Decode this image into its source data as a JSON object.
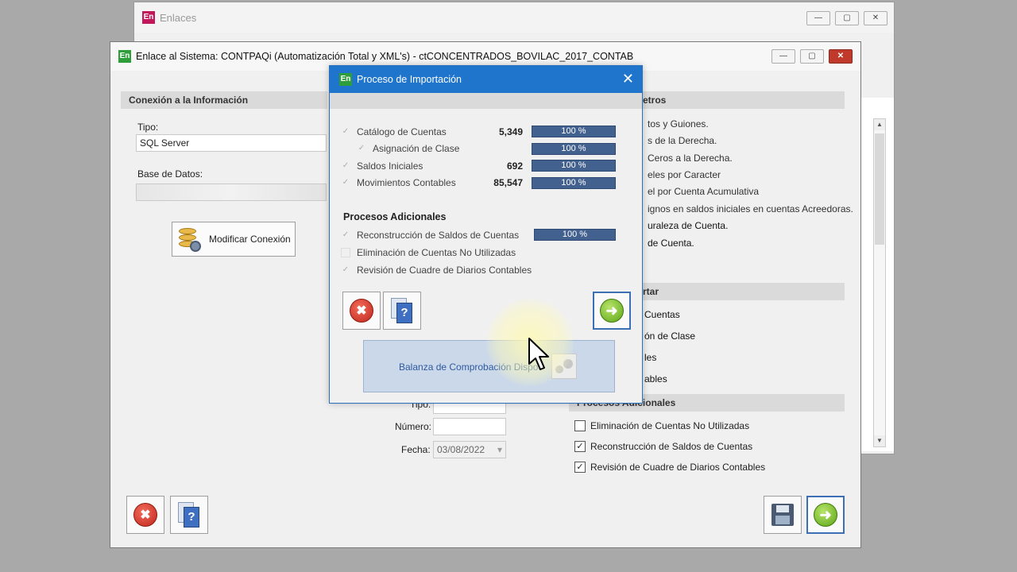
{
  "back_window": {
    "title": "Enlaces",
    "logo": "En"
  },
  "main_window": {
    "logo": "En",
    "title": "Enlace al Sistema: CONTPAQi  (Automatización Total y XML's) - ctCONCENTRADOS_BOVILAC_2017_CONTAB",
    "connection": {
      "header": "Conexión a la Información",
      "tipo_label": "Tipo:",
      "tipo_value": "SQL Server",
      "db_label": "Base de Datos:",
      "modify_button": "Modificar Conexión"
    },
    "params": {
      "header_fragment": "etros",
      "lines": [
        "tos y Guiones.",
        "s de la Derecha.",
        "Ceros a la Derecha.",
        "eles por Caracter",
        "el por Cuenta Acumulativa",
        "ignos en saldos iniciales en cuentas Acreedoras.",
        "uraleza de Cuenta.",
        "de Cuenta."
      ]
    },
    "import": {
      "header_fragment": "rtar",
      "lines": [
        "Cuentas",
        "ón de Clase",
        "les",
        "ables"
      ]
    },
    "additional": {
      "header_fragment": "Procesos Adicionales",
      "items": [
        {
          "label": "Eliminación de Cuentas No Utilizadas",
          "checked": false
        },
        {
          "label": "Reconstrucción de Saldos de Cuentas",
          "checked": true
        },
        {
          "label": "Revisión de Cuadre de Diarios Contables",
          "checked": true
        }
      ]
    },
    "policy": {
      "tipo_label": "Tipo:",
      "numero_label": "Número:",
      "fecha_label": "Fecha:",
      "fecha_value": "03/08/2022"
    }
  },
  "dialog": {
    "logo": "En",
    "title": "Proceso de Importación",
    "close": "✕",
    "rows": [
      {
        "label": "Catálogo de Cuentas",
        "count": "5,349",
        "progress": "100 %"
      },
      {
        "label": "Asignación de Clase",
        "count": "",
        "progress": "100 %"
      },
      {
        "label": "Saldos Iniciales",
        "count": "692",
        "progress": "100 %"
      },
      {
        "label": "Movimientos Contables",
        "count": "85,547",
        "progress": "100 %"
      }
    ],
    "additional_header": "Procesos Adicionales",
    "additional_rows": [
      {
        "label": "Reconstrucción de Saldos de Cuentas",
        "progress": "100 %"
      },
      {
        "label": "Eliminación de Cuentas No Utilizadas",
        "progress": ""
      },
      {
        "label": "Revisión de Cuadre de Diarios Contables",
        "progress": ""
      }
    ],
    "info_text": "Balanza de Comprobación Dispo"
  },
  "icons": {
    "check": "✓",
    "cancel": "✖",
    "help": "?",
    "next": "➜",
    "minimize": "—",
    "maximize": "▢",
    "close": "✕",
    "scroll_up": "▲",
    "scroll_down": "▼",
    "dropdown": "▾"
  },
  "colors": {
    "dialog_title": "#1f75cc",
    "progress_bar": "#43618f",
    "section_header": "#dadada",
    "close_red": "#c0392b"
  }
}
